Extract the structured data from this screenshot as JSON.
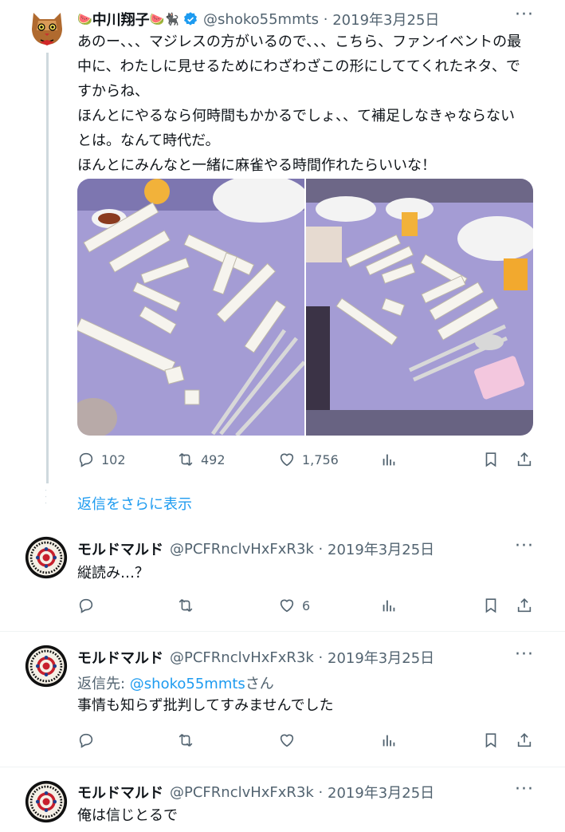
{
  "main_tweet": {
    "name_prefix_emoji": "🍉",
    "name": "中川翔子",
    "name_suffix_emoji": "🍉🐈‍⬛",
    "handle": "@shoko55mmts",
    "date": "2019年3月25日",
    "text": "あのー、、、マジレスの方がいるので、、、こちら、ファンイベントの最中に、わたしに見せるためにわざわざこの形にしててくれたネタ、ですからね、\nほんとにやるなら何時間もかかるでしょ、、て補足しなきゃならないとは。なんて時代だ。\nほんとにみんなと一緒に麻雀やる時間作れたらいいな！",
    "replies": "102",
    "retweets": "492",
    "likes": "1,756"
  },
  "show_more_replies": "返信をさらに表示",
  "replies": [
    {
      "name": "モルドマルド",
      "handle": "@PCFRnclvHxFxR3k",
      "date": "2019年3月25日",
      "text": "縦読み…？",
      "likes": "6"
    },
    {
      "name": "モルドマルド",
      "handle": "@PCFRnclvHxFxR3k",
      "date": "2019年3月25日",
      "reply_to_label": "返信先: ",
      "reply_to_handle": "@shoko55mmts",
      "reply_to_suffix": "さん",
      "text": "事情も知らず批判してすみませんでした",
      "likes": ""
    },
    {
      "name": "モルドマルド",
      "handle": "@PCFRnclvHxFxR3k",
      "date": "2019年3月25日",
      "text": "俺は信じとるで"
    }
  ],
  "colors": {
    "accent": "#1d9bf0",
    "muted": "#536471",
    "tablecloth": "#a49cd4"
  }
}
